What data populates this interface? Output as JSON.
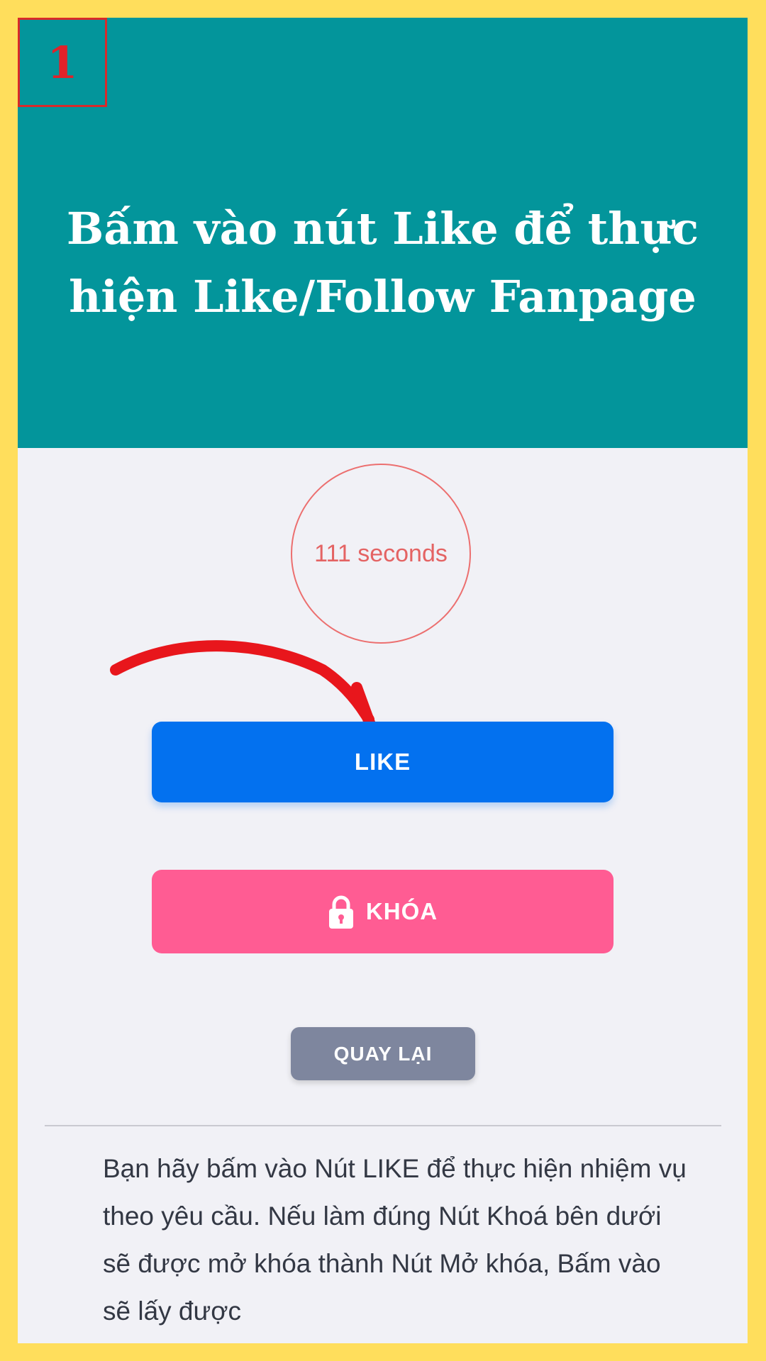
{
  "banner": {
    "step_number": "1",
    "title": "Bấm vào nút Like để thực hiện Like/Follow Fanpage"
  },
  "timer": {
    "text": "111 seconds"
  },
  "buttons": {
    "like_label": "LIKE",
    "lock_label": "KHÓA",
    "back_label": "QUAY LẠI"
  },
  "instruction": {
    "text": "Bạn hãy bấm vào Nút LIKE để thực hiện nhiệm vụ theo yêu cầu. Nếu làm đúng Nút Khoá bên dưới sẽ được mở khóa thành Nút Mở khóa, Bấm vào sẽ lấy được"
  },
  "colors": {
    "frame_border": "#ffde5c",
    "banner_bg": "#03959b",
    "like_button": "#0371ef",
    "lock_button": "#ff5c93",
    "back_button": "#7e869e",
    "timer_ring": "#ec6f6f",
    "arrow": "#e8161c"
  },
  "icons": {
    "lock": "lock-icon",
    "arrow": "curved-arrow-icon"
  }
}
